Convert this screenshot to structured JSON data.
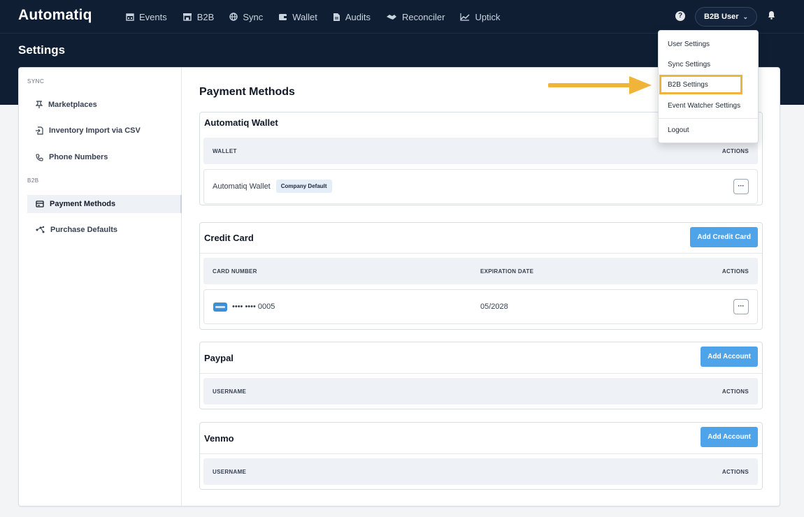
{
  "app": {
    "logo": "Automatiq",
    "nav": [
      {
        "label": "Events",
        "icon": "calendar-icon"
      },
      {
        "label": "B2B",
        "icon": "storefront-icon"
      },
      {
        "label": "Sync",
        "icon": "globe-icon"
      },
      {
        "label": "Wallet",
        "icon": "wallet-icon"
      },
      {
        "label": "Audits",
        "icon": "file-icon"
      },
      {
        "label": "Reconciler",
        "icon": "handshake-icon"
      },
      {
        "label": "Uptick",
        "icon": "trend-up-icon"
      }
    ],
    "help_glyph": "?",
    "user_label": "B2B User",
    "user_chevron": "⌄"
  },
  "page": {
    "title": "Settings"
  },
  "sidebar": {
    "sections": [
      {
        "label": "SYNC",
        "items": [
          {
            "label": "Marketplaces",
            "icon": "pin-icon"
          },
          {
            "label": "Inventory Import via CSV",
            "icon": "file-import-icon"
          },
          {
            "label": "Phone Numbers",
            "icon": "phone-icon"
          }
        ]
      },
      {
        "label": "B2B",
        "items": [
          {
            "label": "Payment Methods",
            "icon": "payment-icon",
            "active": true
          },
          {
            "label": "Purchase Defaults",
            "icon": "network-icon"
          }
        ]
      }
    ]
  },
  "main": {
    "title": "Payment Methods",
    "wallet": {
      "title": "Automatiq Wallet",
      "columns": {
        "wallet": "WALLET",
        "actions": "ACTIONS"
      },
      "row": {
        "name": "Automatiq Wallet",
        "badge": "Company Default",
        "actions": "···"
      }
    },
    "credit_card": {
      "title": "Credit Card",
      "add_label": "Add Credit Card",
      "columns": {
        "card": "CARD NUMBER",
        "expiration": "EXPIRATION DATE",
        "actions": "ACTIONS"
      },
      "row": {
        "card_mask": "•••• •••• 0005",
        "expiration": "05/2028",
        "actions": "···"
      }
    },
    "paypal": {
      "title": "Paypal",
      "add_label": "Add Account",
      "columns": {
        "username": "USERNAME",
        "actions": "ACTIONS"
      }
    },
    "venmo": {
      "title": "Venmo",
      "add_label": "Add Account",
      "columns": {
        "username": "USERNAME",
        "actions": "ACTIONS"
      }
    }
  },
  "user_menu": {
    "items": [
      "User Settings",
      "Sync Settings",
      "B2B Settings",
      "Event Watcher Settings",
      "Logout"
    ],
    "highlighted": "B2B Settings"
  },
  "colors": {
    "header_bg": "#0f1e33",
    "accent_button": "#4fa3e8",
    "highlight": "#f0b43a",
    "arrow": "#f0b43a"
  }
}
